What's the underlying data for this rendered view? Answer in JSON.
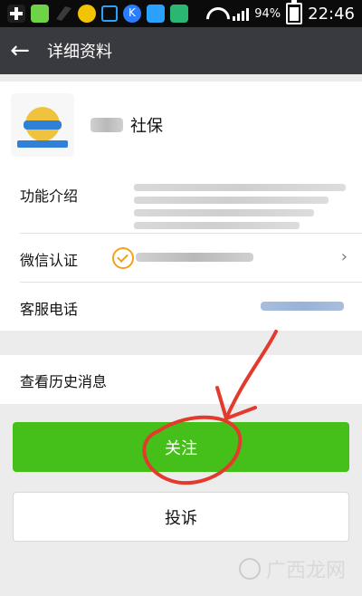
{
  "status": {
    "battery": "94%",
    "time": "22:46",
    "icons": [
      "add-icon",
      "app-icon",
      "leaf-icon",
      "yellow-app-icon",
      "lock-icon",
      "k-app-icon",
      "download-icon",
      "image-icon"
    ]
  },
  "header": {
    "back_icon": "back-arrow-icon",
    "title": "详细资料"
  },
  "profile": {
    "name_visible": "社保"
  },
  "info": {
    "function_label": "功能介绍",
    "verify_label": "微信认证",
    "phone_label": "客服电话"
  },
  "actions": {
    "history_label": "查看历史消息",
    "follow_label": "关注",
    "report_label": "投诉"
  },
  "watermark": {
    "text": "广西龙网"
  },
  "colors": {
    "header_bg": "#393a3f",
    "follow_bg": "#45c01a",
    "annotation_red": "#e23b2e",
    "verify_orange": "#f3a11b"
  }
}
